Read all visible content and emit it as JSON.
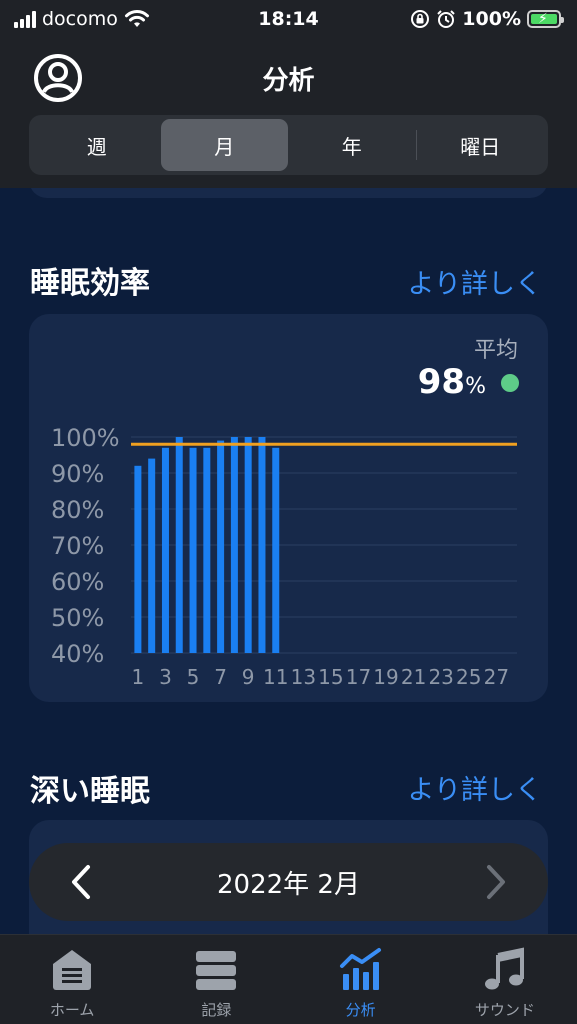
{
  "status": {
    "carrier": "docomo",
    "time": "18:14",
    "battery": "100%"
  },
  "header": {
    "title": "分析"
  },
  "segments": [
    {
      "label": "週",
      "active": false
    },
    {
      "label": "月",
      "active": true
    },
    {
      "label": "年",
      "active": false
    },
    {
      "label": "曜日",
      "active": false
    }
  ],
  "sections": {
    "efficiency": {
      "title": "睡眠効率",
      "more": "より詳しく",
      "avg_label": "平均",
      "avg_value": "98",
      "avg_unit": "%"
    },
    "deep": {
      "title": "深い睡眠",
      "more": "より詳しく"
    }
  },
  "chart_data": {
    "type": "bar",
    "title": "",
    "xlabel": "",
    "ylabel": "",
    "ylim": [
      40,
      100
    ],
    "y_ticks": [
      "100%",
      "90%",
      "80%",
      "70%",
      "60%",
      "50%",
      "40%"
    ],
    "x_ticks": [
      "1",
      "3",
      "5",
      "7",
      "9",
      "11",
      "13",
      "15",
      "17",
      "19",
      "21",
      "23",
      "25",
      "27"
    ],
    "x": [
      1,
      2,
      3,
      4,
      5,
      6,
      7,
      8,
      9,
      10,
      11
    ],
    "values": [
      92,
      94,
      97,
      100,
      97,
      97,
      99,
      100,
      100,
      100,
      97
    ],
    "average": 98,
    "days_in_month": 28,
    "bar_color": "#1a7ff2",
    "average_color": "#f0a020"
  },
  "month_nav": {
    "label": "2022年 2月"
  },
  "tabs": [
    {
      "label": "ホーム",
      "icon": "home-icon",
      "active": false
    },
    {
      "label": "記録",
      "icon": "records-icon",
      "active": false
    },
    {
      "label": "分析",
      "icon": "analysis-icon",
      "active": true
    },
    {
      "label": "サウンド",
      "icon": "music-note-icon",
      "active": false
    }
  ],
  "colors": {
    "accent": "#3a8ef5",
    "background": "#0c1d3b",
    "card": "#17294a",
    "good": "#5ecb88"
  }
}
